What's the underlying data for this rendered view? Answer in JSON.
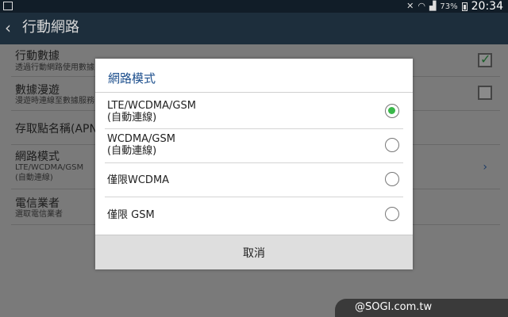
{
  "status_bar": {
    "battery": "73%",
    "time": "20:34"
  },
  "header": {
    "title": "行動網路"
  },
  "settings": [
    {
      "title": "行動數據",
      "subtitle": "透過行動網路使用數據"
    },
    {
      "title": "數據漫遊",
      "subtitle": "漫遊時連線至數據服務"
    },
    {
      "title": "存取點名稱(APN)"
    },
    {
      "title": "網路模式",
      "subtitle_lines": [
        "LTE/WCDMA/GSM",
        "(自動連線)"
      ]
    },
    {
      "title": "電信業者",
      "subtitle": "選取電信業者"
    }
  ],
  "mobile_data_checked": true,
  "data_roaming_checked": false,
  "dialog": {
    "title": "網路模式",
    "options": [
      {
        "lines": [
          "LTE/WCDMA/GSM",
          "(自動連線)"
        ],
        "selected": true
      },
      {
        "lines": [
          "WCDMA/GSM",
          "(自動連線)"
        ],
        "selected": false
      },
      {
        "lines": [
          "僅限WCDMA"
        ],
        "selected": false
      },
      {
        "lines": [
          "僅限 GSM"
        ],
        "selected": false
      }
    ],
    "cancel_label": "取消"
  },
  "watermark": "@SOGI.com.tw",
  "colors": {
    "accent_green": "#3ab84a",
    "dialog_title_blue": "#1d4f8d",
    "action_bar": "#1d2e3c"
  }
}
